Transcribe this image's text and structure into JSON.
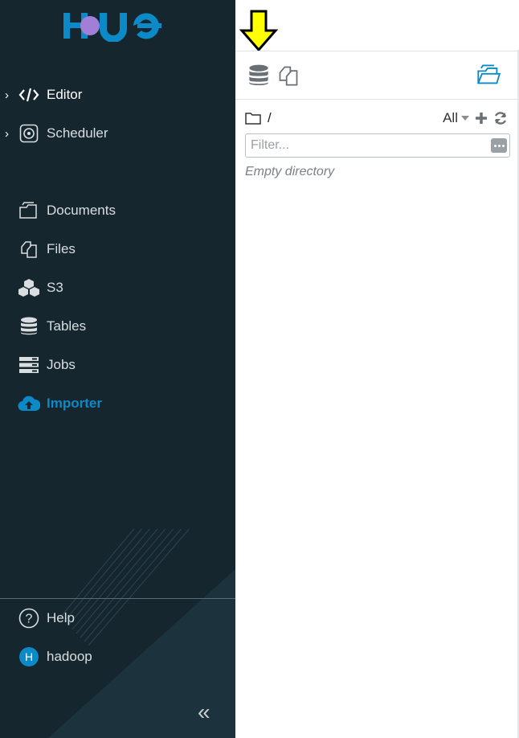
{
  "sidebar": {
    "nav": [
      {
        "label": "Editor",
        "icon": "code-icon"
      },
      {
        "label": "Scheduler",
        "icon": "scheduler-icon"
      }
    ],
    "apps": [
      {
        "label": "Documents",
        "icon": "documents-icon"
      },
      {
        "label": "Files",
        "icon": "files-icon"
      },
      {
        "label": "S3",
        "icon": "s3-cubes-icon"
      },
      {
        "label": "Tables",
        "icon": "database-icon"
      },
      {
        "label": "Jobs",
        "icon": "jobs-icon"
      },
      {
        "label": "Importer",
        "icon": "cloud-upload-icon"
      }
    ],
    "footer": [
      {
        "label": "Help",
        "icon": "help-icon"
      },
      {
        "label": "hadoop",
        "icon": "user-avatar",
        "avatar_letter": "H"
      }
    ],
    "colors": {
      "background": "#15262e",
      "accent": "#0b8ac7"
    }
  },
  "panel": {
    "path": "/",
    "filter_label": "All",
    "filter": {
      "value": "",
      "placeholder": "Filter..."
    },
    "empty_message": "Empty directory"
  },
  "annotation": {
    "arrow_color": "#ffff00",
    "target": "database-tab"
  }
}
